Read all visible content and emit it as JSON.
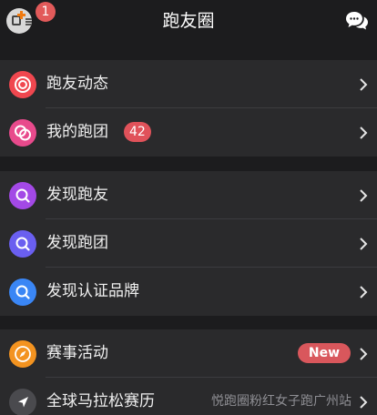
{
  "header": {
    "title": "跑友圈",
    "notification_count": "1"
  },
  "sections": [
    {
      "items": [
        {
          "label": "跑友动态",
          "icon": "target-icon",
          "color": "#f0474f"
        },
        {
          "label": "我的跑团",
          "icon": "group-rings-icon",
          "color": "#e84a8c",
          "badge": "42"
        }
      ]
    },
    {
      "items": [
        {
          "label": "发现跑友",
          "icon": "search-icon",
          "color": "#a349e6"
        },
        {
          "label": "发现跑团",
          "icon": "search-icon",
          "color": "#6a5ff0"
        },
        {
          "label": "发现认证品牌",
          "icon": "search-icon",
          "color": "#3a86f5"
        }
      ]
    },
    {
      "items": [
        {
          "label": "赛事活动",
          "icon": "compass-icon",
          "color": "#f39320",
          "tag": "New"
        },
        {
          "label": "全球马拉松赛历",
          "icon": "navigation-arrow-icon",
          "color": "#4a4a4e",
          "detail": "悦跑圈粉红女子跑广州站"
        }
      ]
    }
  ]
}
